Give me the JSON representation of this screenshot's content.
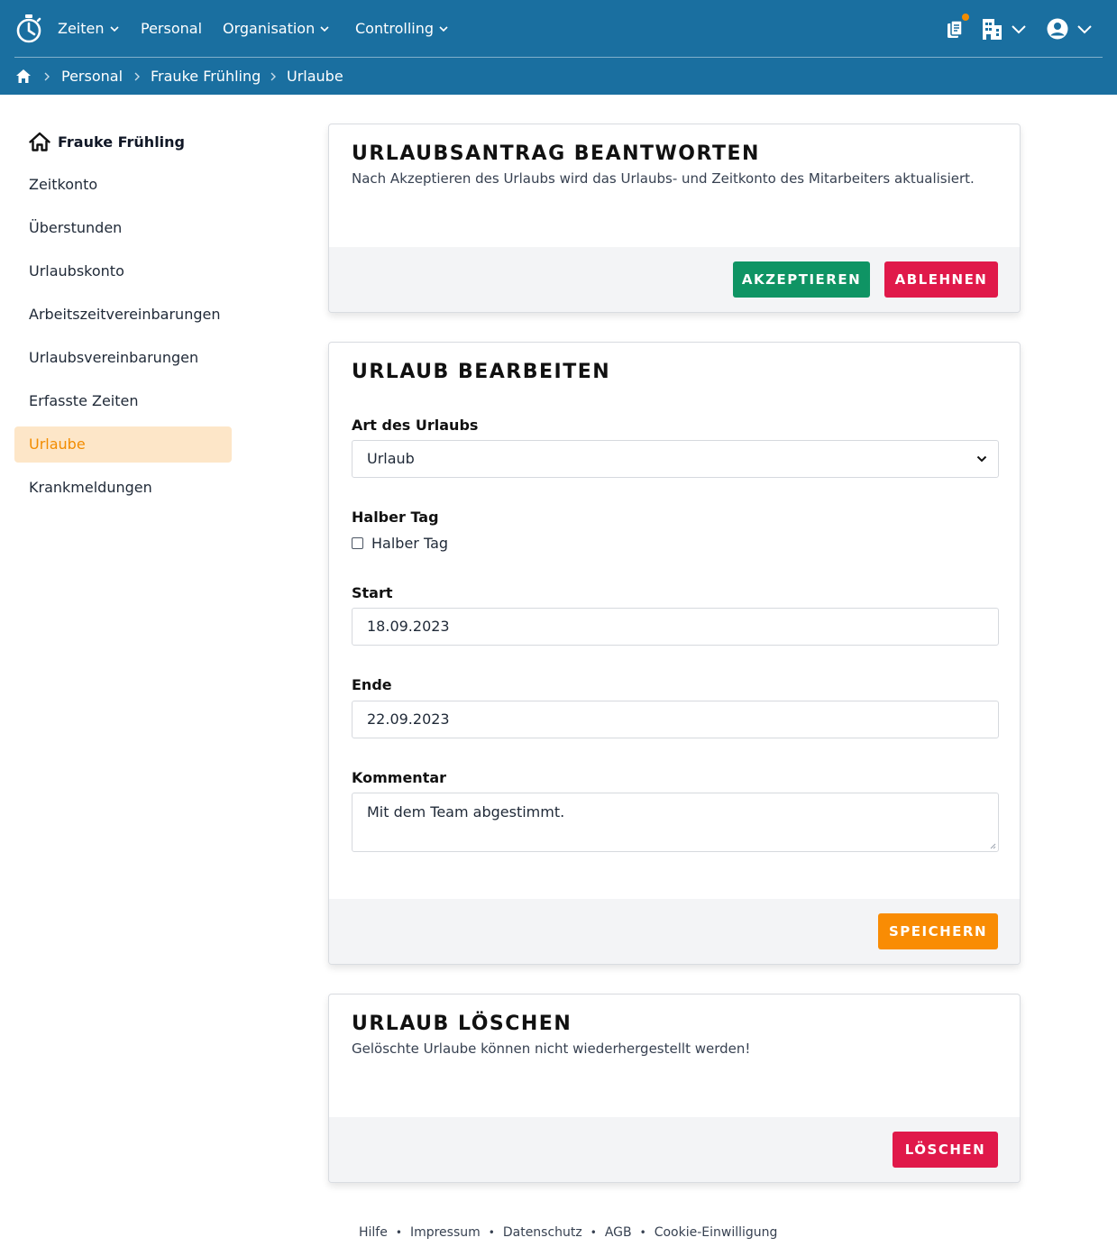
{
  "nav": {
    "items": [
      {
        "label": "Zeiten",
        "has_menu": true
      },
      {
        "label": "Personal",
        "has_menu": false
      },
      {
        "label": "Organisation",
        "has_menu": true
      },
      {
        "label": "Controlling",
        "has_menu": true
      }
    ],
    "icons": [
      "stopwatch-logo-icon",
      "clipboard-icon",
      "building-icon",
      "user-circle-icon"
    ],
    "notification_color": "#f28c00"
  },
  "breadcrumb": [
    "Personal",
    "Frauke Frühling",
    "Urlaube"
  ],
  "sidebar": {
    "title": "Frauke Frühling",
    "items": [
      {
        "label": "Zeitkonto",
        "active": false
      },
      {
        "label": "Überstunden",
        "active": false
      },
      {
        "label": "Urlaubskonto",
        "active": false
      },
      {
        "label": "Arbeitszeitvereinbarungen",
        "active": false
      },
      {
        "label": "Urlaubsvereinbarungen",
        "active": false
      },
      {
        "label": "Erfasste Zeiten",
        "active": false
      },
      {
        "label": "Urlaube",
        "active": true
      },
      {
        "label": "Krankmeldungen",
        "active": false
      }
    ]
  },
  "answer_card": {
    "title": "URLAUBSANTRAG BEANTWORTEN",
    "description": "Nach Akzeptieren des Urlaubs wird das Urlaubs- und Zeitkonto des Mitarbeiters aktualisiert.",
    "accept_label": "AKZEPTIEREN",
    "reject_label": "ABLEHNEN"
  },
  "edit_card": {
    "title": "URLAUB BEARBEITEN",
    "type_label": "Art des Urlaubs",
    "type_value": "Urlaub",
    "half_day_label": "Halber Tag",
    "half_day_checkbox_label": "Halber Tag",
    "half_day_checked": false,
    "start_label": "Start",
    "start_value": "18.09.2023",
    "end_label": "Ende",
    "end_value": "22.09.2023",
    "comment_label": "Kommentar",
    "comment_value": "Mit dem Team abgestimmt.",
    "save_label": "SPEICHERN"
  },
  "delete_card": {
    "title": "URLAUB LÖSCHEN",
    "description": "Gelöschte Urlaube können nicht wiederhergestellt werden!",
    "delete_label": "LÖSCHEN"
  },
  "footer": [
    "Hilfe",
    "Impressum",
    "Datenschutz",
    "AGB",
    "Cookie-Einwilligung"
  ],
  "colors": {
    "header_bg": "#1a6fa0",
    "accent_orange": "#f98c04",
    "active_bg": "#fde6c8",
    "accept_green": "#0f9464",
    "danger_red": "#e0194a"
  }
}
